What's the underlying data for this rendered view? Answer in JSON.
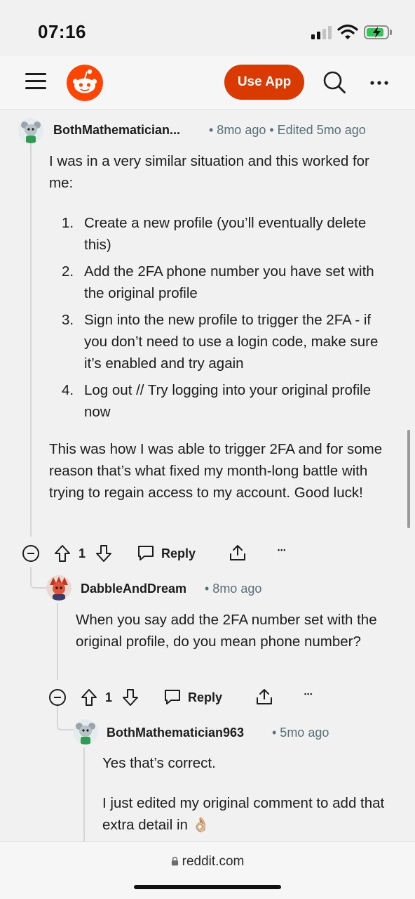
{
  "status_bar": {
    "time": "07:16",
    "battery_charging": true
  },
  "header": {
    "use_app_label": "Use App",
    "icons": [
      "menu-icon",
      "reddit-logo",
      "search-icon",
      "more-icon"
    ]
  },
  "colors": {
    "brand": "#ff4500",
    "use_app": "#d93a00",
    "meta": "#576f76",
    "background": "#f1f1f1"
  },
  "comments": [
    {
      "author": "BothMathematician...",
      "meta": "• 8mo ago • Edited 5mo ago",
      "intro": "I was in a very similar situation and this worked for me:",
      "steps": [
        {
          "num": "1.",
          "text": "Create a new profile (you’ll eventually delete this)"
        },
        {
          "num": "2.",
          "text": "Add the 2FA phone number you have set with the original profile"
        },
        {
          "num": "3.",
          "text": "Sign into the new profile to trigger the 2FA - if you don’t need to use a login code, make sure it’s enabled and try again"
        },
        {
          "num": "4.",
          "text": "Log out // Try logging into your original profile now"
        }
      ],
      "outro": "This was how I was able to trigger 2FA and for some reason that’s what fixed my month-long battle with trying to regain access to my account. Good luck!",
      "votes": "1",
      "reply_label": "Reply",
      "more_label": "•••"
    },
    {
      "author": "DabbleAndDream",
      "meta": "• 8mo ago",
      "body": "When you say add the 2FA number set with the original profile, do you mean phone number?",
      "votes": "1",
      "reply_label": "Reply",
      "more_label": "•••"
    },
    {
      "author": "BothMathematician963",
      "meta": "• 5mo ago",
      "body1": "Yes that’s correct.",
      "body2": "I just edited my original comment to add that extra detail in 👌🏼"
    }
  ],
  "footer": {
    "url": "reddit.com"
  }
}
